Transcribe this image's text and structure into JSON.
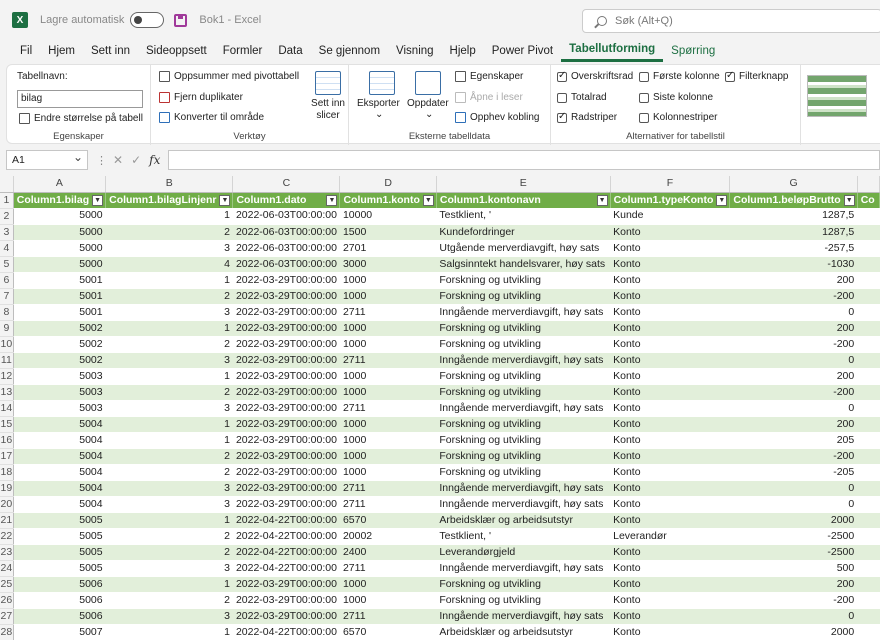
{
  "titlebar": {
    "autosave_label": "Lagre automatisk",
    "doc_title": "Bok1  -  Excel",
    "search_placeholder": "Søk (Alt+Q)"
  },
  "tabs": [
    "Fil",
    "Hjem",
    "Sett inn",
    "Sideoppsett",
    "Formler",
    "Data",
    "Se gjennom",
    "Visning",
    "Hjelp",
    "Power Pivot",
    "Tabellutforming",
    "Spørring"
  ],
  "ribbon": {
    "props": {
      "table_name_label": "Tabellnavn:",
      "table_name_value": "bilag",
      "resize_label": "Endre størrelse på tabell",
      "group_label": "Egenskaper"
    },
    "tools": {
      "pivot": "Oppsummer med pivottabell",
      "dupes": "Fjern duplikater",
      "convert": "Konverter til område",
      "slicer": "Sett inn slicer",
      "group_label": "Verktøy"
    },
    "external": {
      "export": "Eksporter",
      "refresh": "Oppdater",
      "props": "Egenskaper",
      "open_browser": "Åpne i leser",
      "unlink": "Opphev kobling",
      "group_label": "Eksterne tabelldata"
    },
    "options": {
      "header_row": "Overskriftsrad",
      "first_col": "Første kolonne",
      "filter_btn": "Filterknapp",
      "total_row": "Totalrad",
      "last_col": "Siste kolonne",
      "banded_rows": "Radstriper",
      "banded_cols": "Kolonnestriper",
      "group_label": "Alternativer for tabellstil"
    }
  },
  "formula": {
    "namebox": "A1",
    "fx": "fx"
  },
  "columns": [
    "A",
    "B",
    "C",
    "D",
    "E",
    "F",
    "G"
  ],
  "headers": [
    "Column1.bilag",
    "Column1.bilagLinjenr",
    "Column1.dato",
    "Column1.konto",
    "Column1.kontonavn",
    "Column1.typeKonto",
    "Column1.beløpBrutto",
    "Co"
  ],
  "rows": [
    [
      "5000",
      "1",
      "2022-06-03T00:00:00",
      "10000",
      "Testklient, '",
      "Kunde",
      "1287,5"
    ],
    [
      "5000",
      "2",
      "2022-06-03T00:00:00",
      "1500",
      "Kundefordringer",
      "Konto",
      "1287,5"
    ],
    [
      "5000",
      "3",
      "2022-06-03T00:00:00",
      "2701",
      "Utgående merverdiavgift, høy sats",
      "Konto",
      "-257,5"
    ],
    [
      "5000",
      "4",
      "2022-06-03T00:00:00",
      "3000",
      "Salgsinntekt handelsvarer, høy sats",
      "Konto",
      "-1030"
    ],
    [
      "5001",
      "1",
      "2022-03-29T00:00:00",
      "1000",
      "Forskning og utvikling",
      "Konto",
      "200"
    ],
    [
      "5001",
      "2",
      "2022-03-29T00:00:00",
      "1000",
      "Forskning og utvikling",
      "Konto",
      "-200"
    ],
    [
      "5001",
      "3",
      "2022-03-29T00:00:00",
      "2711",
      "Inngående merverdiavgift, høy sats",
      "Konto",
      "0"
    ],
    [
      "5002",
      "1",
      "2022-03-29T00:00:00",
      "1000",
      "Forskning og utvikling",
      "Konto",
      "200"
    ],
    [
      "5002",
      "2",
      "2022-03-29T00:00:00",
      "1000",
      "Forskning og utvikling",
      "Konto",
      "-200"
    ],
    [
      "5002",
      "3",
      "2022-03-29T00:00:00",
      "2711",
      "Inngående merverdiavgift, høy sats",
      "Konto",
      "0"
    ],
    [
      "5003",
      "1",
      "2022-03-29T00:00:00",
      "1000",
      "Forskning og utvikling",
      "Konto",
      "200"
    ],
    [
      "5003",
      "2",
      "2022-03-29T00:00:00",
      "1000",
      "Forskning og utvikling",
      "Konto",
      "-200"
    ],
    [
      "5003",
      "3",
      "2022-03-29T00:00:00",
      "2711",
      "Inngående merverdiavgift, høy sats",
      "Konto",
      "0"
    ],
    [
      "5004",
      "1",
      "2022-03-29T00:00:00",
      "1000",
      "Forskning og utvikling",
      "Konto",
      "200"
    ],
    [
      "5004",
      "1",
      "2022-03-29T00:00:00",
      "1000",
      "Forskning og utvikling",
      "Konto",
      "205"
    ],
    [
      "5004",
      "2",
      "2022-03-29T00:00:00",
      "1000",
      "Forskning og utvikling",
      "Konto",
      "-200"
    ],
    [
      "5004",
      "2",
      "2022-03-29T00:00:00",
      "1000",
      "Forskning og utvikling",
      "Konto",
      "-205"
    ],
    [
      "5004",
      "3",
      "2022-03-29T00:00:00",
      "2711",
      "Inngående merverdiavgift, høy sats",
      "Konto",
      "0"
    ],
    [
      "5004",
      "3",
      "2022-03-29T00:00:00",
      "2711",
      "Inngående merverdiavgift, høy sats",
      "Konto",
      "0"
    ],
    [
      "5005",
      "1",
      "2022-04-22T00:00:00",
      "6570",
      "Arbeidsklær og arbeidsutstyr",
      "Konto",
      "2000"
    ],
    [
      "5005",
      "2",
      "2022-04-22T00:00:00",
      "20002",
      "Testklient, '",
      "Leverandør",
      "-2500"
    ],
    [
      "5005",
      "2",
      "2022-04-22T00:00:00",
      "2400",
      "Leverandørgjeld",
      "Konto",
      "-2500"
    ],
    [
      "5005",
      "3",
      "2022-04-22T00:00:00",
      "2711",
      "Inngående merverdiavgift, høy sats",
      "Konto",
      "500"
    ],
    [
      "5006",
      "1",
      "2022-03-29T00:00:00",
      "1000",
      "Forskning og utvikling",
      "Konto",
      "200"
    ],
    [
      "5006",
      "2",
      "2022-03-29T00:00:00",
      "1000",
      "Forskning og utvikling",
      "Konto",
      "-200"
    ],
    [
      "5006",
      "3",
      "2022-03-29T00:00:00",
      "2711",
      "Inngående merverdiavgift, høy sats",
      "Konto",
      "0"
    ],
    [
      "5007",
      "1",
      "2022-04-22T00:00:00",
      "6570",
      "Arbeidsklær og arbeidsutstyr",
      "Konto",
      "2000"
    ]
  ]
}
